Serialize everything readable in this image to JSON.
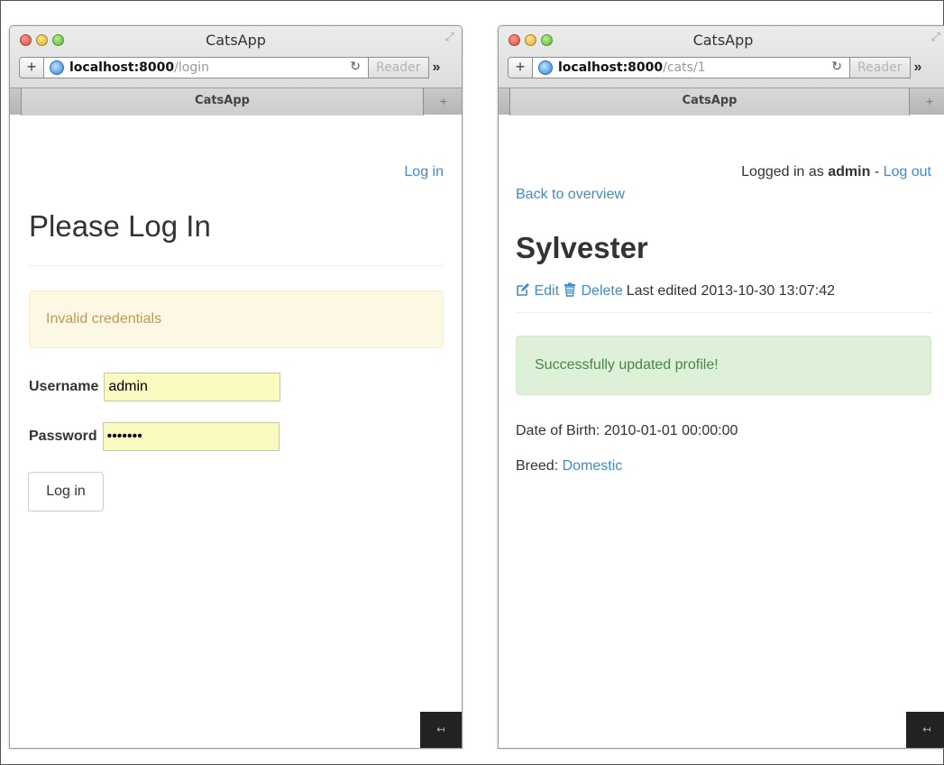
{
  "left_window": {
    "title": "CatsApp",
    "url_host": "localhost:8000",
    "url_path": "/login",
    "reader_label": "Reader",
    "tab_label": "CatsApp",
    "page": {
      "nav_login": "Log in",
      "heading": "Please Log In",
      "alert": "Invalid credentials",
      "username_label": "Username",
      "username_value": "admin",
      "password_label": "Password",
      "password_value": "•••••••",
      "submit_label": "Log in"
    }
  },
  "right_window": {
    "title": "CatsApp",
    "url_host": "localhost:8000",
    "url_path": "/cats/1",
    "reader_label": "Reader",
    "tab_label": "CatsApp",
    "page": {
      "logged_in_prefix": "Logged in as",
      "logged_in_user": "admin",
      "separator": "-",
      "logout": "Log out",
      "back_link": "Back to overview",
      "heading": "Sylvester",
      "edit": "Edit",
      "delete": "Delete",
      "last_edited": "Last edited 2013-10-30 13:07:42",
      "alert": "Successfully updated profile!",
      "dob_label": "Date of Birth:",
      "dob_value": "2010-01-01 00:00:00",
      "breed_label": "Breed:",
      "breed_value": "Domestic"
    }
  },
  "colors": {
    "link": "#428bca",
    "warning_bg": "#fcf8e3",
    "warning_text": "#c09853",
    "success_bg": "#dff0d8",
    "success_text": "#468847",
    "autofill_bg": "#fafbc0"
  },
  "icons": [
    "globe-icon",
    "reload-icon",
    "chevron-right-icon",
    "new-tab-icon",
    "fullscreen-icon",
    "edit-icon",
    "trash-icon"
  ]
}
